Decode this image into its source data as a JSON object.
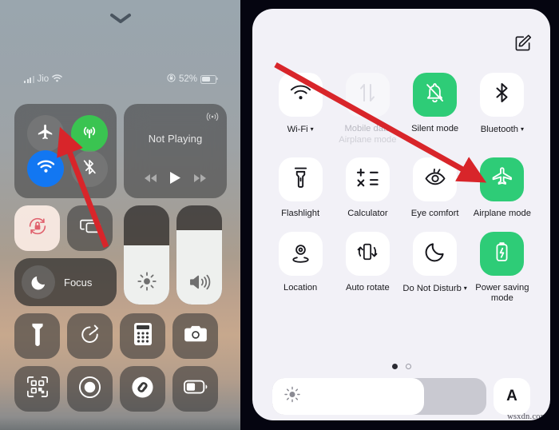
{
  "ios": {
    "handle_icon": "chevron-down-icon",
    "status_bar": {
      "carrier": "Jio",
      "signal_icon": "cellular-signal-icon",
      "wifi_icon": "wifi-icon",
      "orientation_lock_icon": "rotation-lock-status-icon",
      "battery_percent": "52%",
      "battery_icon": "battery-icon"
    },
    "connectivity": {
      "airplane": {
        "label": "Airplane Mode",
        "icon": "airplane-icon",
        "state": "off"
      },
      "cellular": {
        "label": "Cellular Data",
        "icon": "cellular-antenna-icon",
        "state": "on"
      },
      "wifi": {
        "label": "Wi-Fi",
        "icon": "wifi-icon",
        "state": "on"
      },
      "bluetooth": {
        "label": "Bluetooth",
        "icon": "bluetooth-slash-icon",
        "state": "off"
      }
    },
    "media": {
      "title": "Not Playing",
      "airplay_icon": "airplay-icon",
      "prev_icon": "rewind-icon",
      "play_icon": "play-icon",
      "next_icon": "fast-forward-icon"
    },
    "tiles": {
      "rotation_lock": {
        "label": "Rotation Lock",
        "icon": "rotation-lock-icon",
        "state": "on"
      },
      "screen_mirroring": {
        "label": "Screen Mirroring",
        "icon": "screen-mirroring-icon",
        "state": "off"
      },
      "focus": {
        "label": "Focus",
        "icon": "moon-icon"
      },
      "brightness": {
        "label": "Brightness",
        "icon": "brightness-sun-icon",
        "value": 60
      },
      "volume": {
        "label": "Volume",
        "icon": "speaker-icon",
        "value": 75
      },
      "flashlight": {
        "label": "Flashlight",
        "icon": "flashlight-icon"
      },
      "timer": {
        "label": "Timer",
        "icon": "timer-icon"
      },
      "calculator": {
        "label": "Calculator",
        "icon": "calculator-icon"
      },
      "camera": {
        "label": "Camera",
        "icon": "camera-icon"
      },
      "qr_scanner": {
        "label": "Code Scanner",
        "icon": "qr-code-icon"
      },
      "screen_record": {
        "label": "Screen Recording",
        "icon": "record-icon"
      },
      "shazam": {
        "label": "Music Recognition",
        "icon": "shazam-icon"
      },
      "low_power": {
        "label": "Low Power Mode",
        "icon": "low-battery-icon"
      }
    }
  },
  "android": {
    "edit_icon": "edit-pencil-square-icon",
    "accent_on": "#2ecc77",
    "panel_bg": "#f2f1f7",
    "tiles": [
      {
        "label": "Wi-Fi",
        "icon": "wifi-icon",
        "state": "off",
        "has_caret": true,
        "sub": ""
      },
      {
        "label": "Mobile data",
        "icon": "data-transfer-icon",
        "state": "disabled",
        "has_caret": false,
        "sub": "Airplane mode"
      },
      {
        "label": "Silent mode",
        "icon": "bell-slash-icon",
        "state": "on",
        "has_caret": false,
        "sub": ""
      },
      {
        "label": "Bluetooth",
        "icon": "bluetooth-icon",
        "state": "off",
        "has_caret": true,
        "sub": ""
      },
      {
        "label": "Flashlight",
        "icon": "flashlight-icon",
        "state": "off",
        "has_caret": false,
        "sub": ""
      },
      {
        "label": "Calculator",
        "icon": "calculator-icon",
        "state": "off",
        "has_caret": false,
        "sub": ""
      },
      {
        "label": "Eye comfort",
        "icon": "eye-comfort-icon",
        "state": "off",
        "has_caret": false,
        "sub": ""
      },
      {
        "label": "Airplane mode",
        "icon": "airplane-icon",
        "state": "on",
        "has_caret": false,
        "sub": ""
      },
      {
        "label": "Location",
        "icon": "location-pin-icon",
        "state": "off",
        "has_caret": false,
        "sub": ""
      },
      {
        "label": "Auto rotate",
        "icon": "auto-rotate-icon",
        "state": "off",
        "has_caret": false,
        "sub": ""
      },
      {
        "label": "Do Not Disturb",
        "icon": "moon-icon",
        "state": "off",
        "has_caret": true,
        "sub": ""
      },
      {
        "label": "Power saving mode",
        "icon": "battery-saver-icon",
        "state": "on",
        "has_caret": false,
        "sub": ""
      }
    ],
    "pagination": {
      "total": 2,
      "active_index": 0
    },
    "brightness": {
      "icon": "brightness-sun-icon",
      "value": 71
    },
    "auto_brightness": {
      "label": "A",
      "icon": "auto-brightness-icon"
    },
    "watermark": "wsxdn.com"
  },
  "annotations": {
    "arrow_color": "#d8252a",
    "left_arrow": {
      "from": [
        132,
        306
      ],
      "to": [
        78,
        170
      ],
      "points_at": "ios-airplane-mode-button"
    },
    "right_arrow": {
      "from": [
        346,
        82
      ],
      "to": [
        598,
        223
      ],
      "points_at": "android-airplane-mode-tile"
    }
  }
}
